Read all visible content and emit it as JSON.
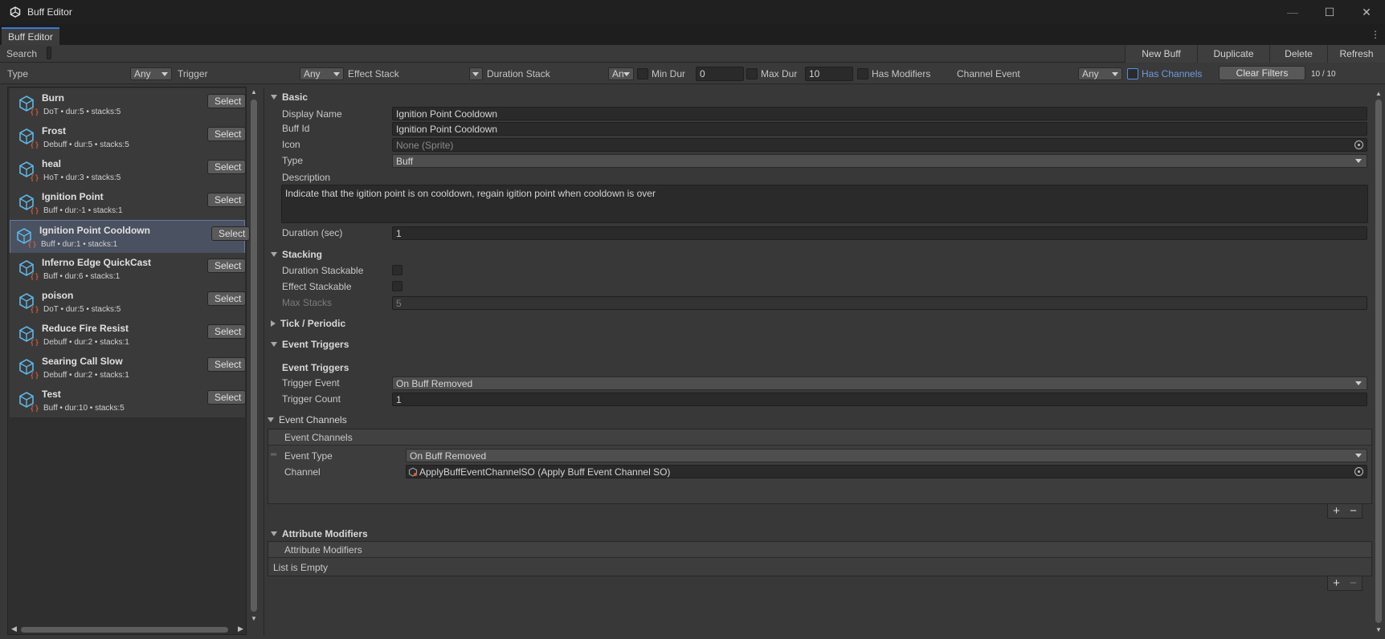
{
  "window": {
    "title": "Buff Editor",
    "minimize": "—",
    "maximize": "☐",
    "close": "✕"
  },
  "tab": {
    "label": "Buff Editor",
    "menu": "⋮"
  },
  "toolbar": {
    "search_label": "Search",
    "buttons": {
      "new_buff": "New Buff",
      "duplicate": "Duplicate",
      "delete": "Delete",
      "refresh": "Refresh"
    }
  },
  "filters": {
    "type_label": "Type",
    "type_value": "Any",
    "trigger_label": "Trigger",
    "trigger_value": "Any",
    "effect_stack_label": "Effect Stack",
    "effect_stack_value": "",
    "duration_stack_label": "Duration Stack",
    "duration_stack_value": "An",
    "min_dur_label": "Min Dur",
    "min_dur_value": "0",
    "max_dur_label": "Max Dur",
    "max_dur_value": "10",
    "has_modifiers_label": "Has Modifiers",
    "channel_event_label": "Channel Event",
    "channel_event_value": "Any",
    "has_channels_label": "Has Channels",
    "clear_filters": "Clear Filters",
    "count": "10 / 10"
  },
  "buff_list": {
    "select_label": "Select",
    "items": [
      {
        "name": "Burn",
        "sub": "DoT • dur:5 • stacks:5"
      },
      {
        "name": "Frost",
        "sub": "Debuff • dur:5 • stacks:5"
      },
      {
        "name": "heal",
        "sub": "HoT • dur:3 • stacks:5"
      },
      {
        "name": "Ignition Point",
        "sub": "Buff • dur:-1 • stacks:1"
      },
      {
        "name": "Ignition Point Cooldown",
        "sub": "Buff • dur:1 • stacks:1"
      },
      {
        "name": "Inferno Edge QuickCast",
        "sub": "Buff • dur:6 • stacks:1"
      },
      {
        "name": "poison",
        "sub": "DoT • dur:5 • stacks:5"
      },
      {
        "name": "Reduce Fire Resist",
        "sub": "Debuff • dur:2 • stacks:1"
      },
      {
        "name": "Searing Call Slow",
        "sub": "Debuff • dur:2 • stacks:1"
      },
      {
        "name": "Test",
        "sub": "Buff • dur:10 • stacks:5"
      }
    ]
  },
  "inspector": {
    "basic": {
      "title": "Basic",
      "display_name_label": "Display Name",
      "display_name": "Ignition Point Cooldown",
      "buff_id_label": "Buff Id",
      "buff_id": "Ignition Point Cooldown",
      "icon_label": "Icon",
      "icon": "None (Sprite)",
      "type_label": "Type",
      "type": "Buff",
      "description_label": "Description",
      "description": "Indicate that the igition point is on cooldown, regain igition point when cooldown is over",
      "duration_label": "Duration (sec)",
      "duration": "1"
    },
    "stacking": {
      "title": "Stacking",
      "duration_stackable_label": "Duration Stackable",
      "effect_stackable_label": "Effect Stackable",
      "max_stacks_label": "Max Stacks",
      "max_stacks": "5"
    },
    "tick": {
      "title": "Tick / Periodic"
    },
    "event_triggers": {
      "title": "Event Triggers",
      "subtitle": "Event Triggers",
      "trigger_event_label": "Trigger Event",
      "trigger_event": "On Buff Removed",
      "trigger_count_label": "Trigger Count",
      "trigger_count": "1"
    },
    "event_channels": {
      "title": "Event Channels",
      "list_header": "Event Channels",
      "event_type_label": "Event Type",
      "event_type": "On Buff Removed",
      "channel_label": "Channel",
      "channel": "ApplyBuffEventChannelSO (Apply Buff Event Channel SO)",
      "add": "+",
      "remove": "−"
    },
    "attribute_modifiers": {
      "title": "Attribute Modifiers",
      "list_header": "Attribute Modifiers",
      "empty": "List is Empty",
      "add": "+",
      "remove": "−"
    }
  }
}
